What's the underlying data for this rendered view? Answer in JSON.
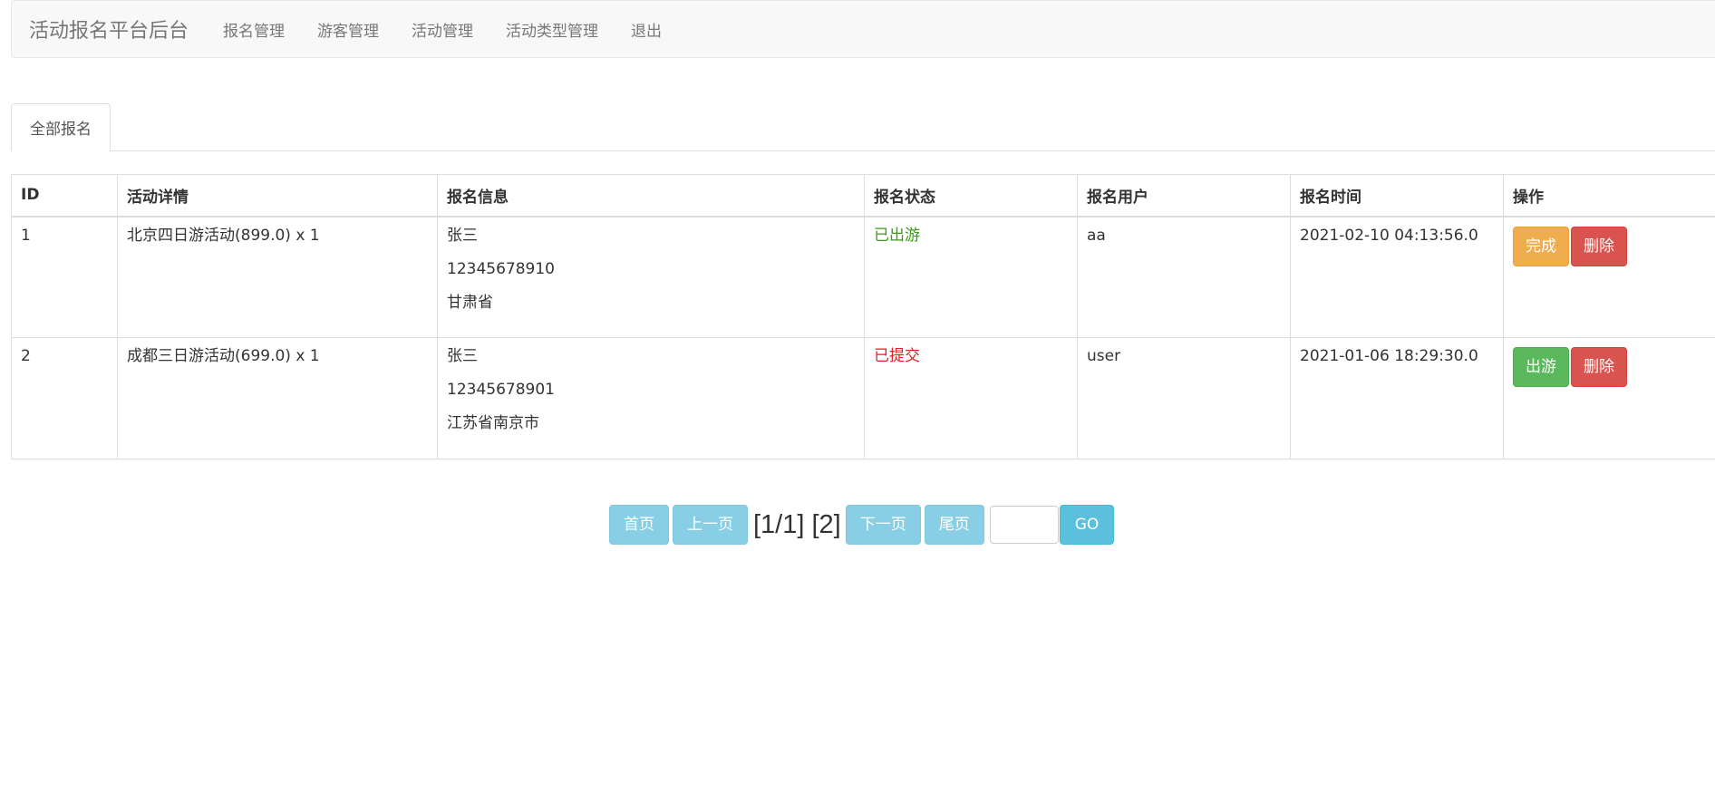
{
  "navbar": {
    "brand": "活动报名平台后台",
    "links": [
      "报名管理",
      "游客管理",
      "活动管理",
      "活动类型管理",
      "退出"
    ]
  },
  "tabs": [
    "全部报名"
  ],
  "table": {
    "headers": [
      "ID",
      "活动详情",
      "报名信息",
      "报名状态",
      "报名用户",
      "报名时间",
      "操作"
    ],
    "rows": [
      {
        "id": "1",
        "detail": "北京四日游活动(899.0) x 1",
        "info": [
          "张三",
          "12345678910",
          "甘肃省"
        ],
        "status": "已出游",
        "status_color": "#3c9a1c",
        "user": "aa",
        "time": "2021-02-10 04:13:56.0",
        "actions": [
          "完成",
          "删除"
        ]
      },
      {
        "id": "2",
        "detail": "成都三日游活动(699.0) x 1",
        "info": [
          "张三",
          "12345678901",
          "江苏省南京市"
        ],
        "status": "已提交",
        "status_color": "#e02020",
        "user": "user",
        "time": "2021-01-06 18:29:30.0",
        "actions": [
          "出游",
          "删除"
        ]
      }
    ]
  },
  "pagination": {
    "first": "首页",
    "prev": "上一页",
    "page_info": "[1/1] [2]",
    "next": "下一页",
    "last": "尾页",
    "go": "GO",
    "input_value": ""
  },
  "colors": {
    "warning": "#f0ad4e",
    "danger": "#d9534f",
    "success": "#5cb85c",
    "info": "#5bc0de",
    "info_disabled": "#88cfe6"
  }
}
